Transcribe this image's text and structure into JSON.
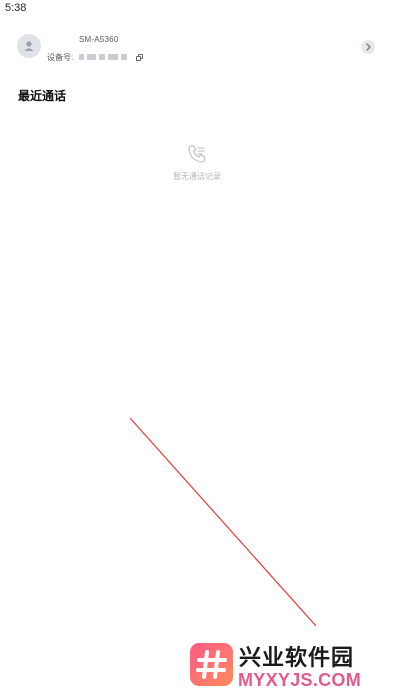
{
  "status_bar": {
    "time": "5:38"
  },
  "device": {
    "model": "SM-A5360",
    "id_label": "设备号:",
    "avatar_icon": "person-icon",
    "copy_icon": "copy-icon",
    "detail_icon": "chevron-right-icon"
  },
  "recent_calls": {
    "title": "最近通话",
    "empty_icon": "phone-call-icon",
    "empty_text": "暂无通话记录"
  },
  "annotation": {
    "color": "#e53935"
  },
  "watermark": {
    "title": "兴业软件园",
    "url": "MYXYJS.COM",
    "colors": {
      "logo_start": "#ff5b88",
      "logo_end": "#ff8a5b",
      "url": "#e35a8e"
    }
  }
}
